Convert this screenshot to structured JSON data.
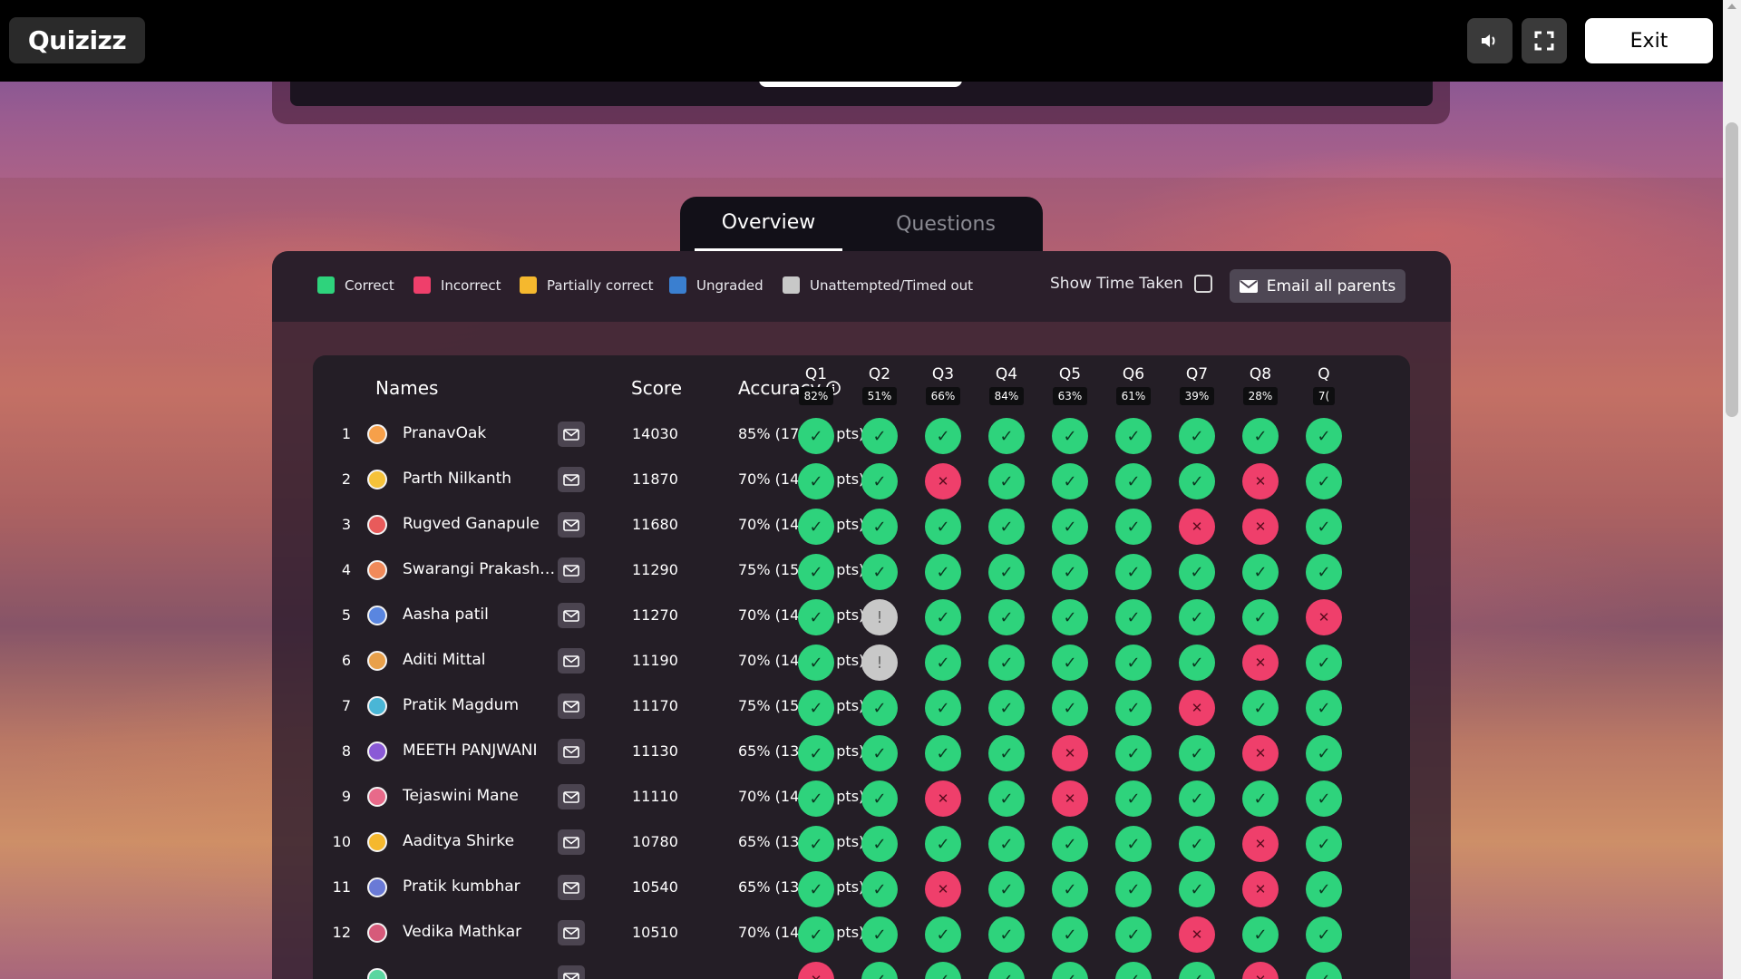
{
  "topbar": {
    "logo": "Quizizz",
    "sound_icon": "speaker-icon",
    "fullscreen_icon": "fullscreen-icon",
    "exit_label": "Exit"
  },
  "tabs": [
    {
      "label": "Overview",
      "active": true
    },
    {
      "label": "Questions",
      "active": false
    }
  ],
  "legend": [
    {
      "label": "Correct",
      "color": "#2ed37c"
    },
    {
      "label": "Incorrect",
      "color": "#ef3f6b"
    },
    {
      "label": "Partially correct",
      "color": "#f5b82e"
    },
    {
      "label": "Ungraded",
      "color": "#3a7fd0"
    },
    {
      "label": "Unattempted/Timed out",
      "color": "#c8c8c8"
    }
  ],
  "show_time_label": "Show Time Taken",
  "email_all_label": "Email all parents",
  "table": {
    "headers": {
      "names": "Names",
      "score": "Score",
      "accuracy": "Accuracy"
    },
    "questions": [
      {
        "label": "Q1",
        "pct": "82%"
      },
      {
        "label": "Q2",
        "pct": "51%"
      },
      {
        "label": "Q3",
        "pct": "66%"
      },
      {
        "label": "Q4",
        "pct": "84%"
      },
      {
        "label": "Q5",
        "pct": "63%"
      },
      {
        "label": "Q6",
        "pct": "61%"
      },
      {
        "label": "Q7",
        "pct": "39%"
      },
      {
        "label": "Q8",
        "pct": "28%"
      },
      {
        "label": "Q",
        "pct": "7("
      }
    ],
    "rows": [
      {
        "rank": "1",
        "name": "PranavOak",
        "score": "14030",
        "accuracy": "85% (17 / 20 pts)",
        "avatar": "#f6a04a",
        "results": [
          "c",
          "c",
          "c",
          "c",
          "c",
          "c",
          "c",
          "c",
          "c"
        ]
      },
      {
        "rank": "2",
        "name": "Parth Nilkanth",
        "score": "11870",
        "accuracy": "70% (14 / 20 pts)",
        "avatar": "#f5c23a",
        "results": [
          "c",
          "c",
          "i",
          "c",
          "c",
          "c",
          "c",
          "i",
          "c"
        ]
      },
      {
        "rank": "3",
        "name": "Rugved Ganapule",
        "score": "11680",
        "accuracy": "70% (14 / 20 pts)",
        "avatar": "#e85b5b",
        "results": [
          "c",
          "c",
          "c",
          "c",
          "c",
          "c",
          "i",
          "i",
          "c"
        ]
      },
      {
        "rank": "4",
        "name": "Swarangi Prakash…",
        "score": "11290",
        "accuracy": "75% (15 / 20 pts)",
        "avatar": "#f08a5a",
        "results": [
          "c",
          "c",
          "c",
          "c",
          "c",
          "c",
          "c",
          "c",
          "c"
        ]
      },
      {
        "rank": "5",
        "name": "Aasha patil",
        "score": "11270",
        "accuracy": "70% (14 / 20 pts)",
        "avatar": "#5a86e0",
        "results": [
          "c",
          "u",
          "c",
          "c",
          "c",
          "c",
          "c",
          "c",
          "i"
        ]
      },
      {
        "rank": "6",
        "name": "Aditi Mittal",
        "score": "11190",
        "accuracy": "70% (14 / 20 pts)",
        "avatar": "#e8a04a",
        "results": [
          "c",
          "u",
          "c",
          "c",
          "c",
          "c",
          "c",
          "i",
          "c"
        ]
      },
      {
        "rank": "7",
        "name": "Pratik Magdum",
        "score": "11170",
        "accuracy": "75% (15 / 20 pts)",
        "avatar": "#4ab6d6",
        "results": [
          "c",
          "c",
          "c",
          "c",
          "c",
          "c",
          "i",
          "c",
          "c"
        ]
      },
      {
        "rank": "8",
        "name": "MEETH PANJWANI",
        "score": "11130",
        "accuracy": "65% (13 / 20 pts)",
        "avatar": "#8a5ad6",
        "results": [
          "c",
          "c",
          "c",
          "c",
          "i",
          "c",
          "c",
          "i",
          "c"
        ]
      },
      {
        "rank": "9",
        "name": "Tejaswini Mane",
        "score": "11110",
        "accuracy": "70% (14 / 20 pts)",
        "avatar": "#e86a8a",
        "results": [
          "c",
          "c",
          "i",
          "c",
          "i",
          "c",
          "c",
          "c",
          "c"
        ]
      },
      {
        "rank": "10",
        "name": "Aaditya Shirke",
        "score": "10780",
        "accuracy": "65% (13 / 20 pts)",
        "avatar": "#f5b82e",
        "results": [
          "c",
          "c",
          "c",
          "c",
          "c",
          "c",
          "c",
          "i",
          "c"
        ]
      },
      {
        "rank": "11",
        "name": "Pratik kumbhar",
        "score": "10540",
        "accuracy": "65% (13 / 20 pts)",
        "avatar": "#6a7ad6",
        "results": [
          "c",
          "c",
          "i",
          "c",
          "c",
          "c",
          "c",
          "i",
          "c"
        ]
      },
      {
        "rank": "12",
        "name": "Vedika Mathkar",
        "score": "10510",
        "accuracy": "70% (14 / 20 pts)",
        "avatar": "#d65a7a",
        "results": [
          "c",
          "c",
          "c",
          "c",
          "c",
          "c",
          "i",
          "c",
          "c"
        ]
      },
      {
        "rank": "",
        "name": "",
        "score": "",
        "accuracy": "",
        "avatar": "#5ad6a0",
        "results": [
          "i",
          "c",
          "c",
          "c",
          "c",
          "c",
          "c",
          "i",
          "c"
        ]
      }
    ]
  }
}
